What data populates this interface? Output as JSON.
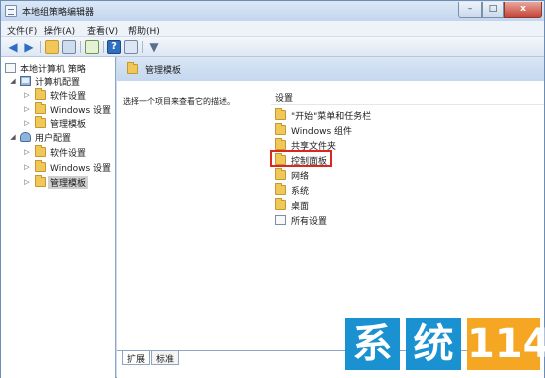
{
  "window": {
    "title": "本地组策略编辑器"
  },
  "titlebar_buttons": {
    "minimize": "–",
    "maximize": "□",
    "close": "x"
  },
  "menu": [
    "文件(F)",
    "操作(A)",
    "查看(V)",
    "帮助(H)"
  ],
  "toolbar_icons": [
    "back-icon",
    "forward-icon",
    "up-folder-icon",
    "show-hide-tree-icon",
    "export-icon",
    "help-icon",
    "properties-icon",
    "filter-icon"
  ],
  "tree": [
    {
      "label": "本地计算机 策略",
      "icon": "doc-icon"
    },
    {
      "label": "计算机配置",
      "icon": "computer-icon",
      "expanded": true
    },
    {
      "label": "软件设置",
      "icon": "folder-icon"
    },
    {
      "label": "Windows 设置",
      "icon": "folder-icon"
    },
    {
      "label": "管理模板",
      "icon": "folder-icon"
    },
    {
      "label": "用户配置",
      "icon": "user-icon",
      "expanded": true
    },
    {
      "label": "软件设置",
      "icon": "folder-icon"
    },
    {
      "label": "Windows 设置",
      "icon": "folder-icon"
    },
    {
      "label": "管理模板",
      "icon": "folder-icon",
      "selected": true
    }
  ],
  "right": {
    "header_title": "管理模板",
    "description": "选择一个项目来查看它的描述。",
    "column_header": "设置",
    "items": [
      {
        "label": "\"开始\"菜单和任务栏",
        "icon": "folder-icon"
      },
      {
        "label": "Windows 组件",
        "icon": "folder-icon"
      },
      {
        "label": "共享文件夹",
        "icon": "folder-icon"
      },
      {
        "label": "控制面板",
        "icon": "folder-icon",
        "highlighted": true
      },
      {
        "label": "网络",
        "icon": "folder-icon"
      },
      {
        "label": "系统",
        "icon": "folder-icon"
      },
      {
        "label": "桌面",
        "icon": "folder-icon"
      },
      {
        "label": "所有设置",
        "icon": "settings-icon"
      }
    ],
    "tabs": [
      "扩展",
      "标准"
    ]
  },
  "watermark": {
    "char1": "系",
    "char2": "统",
    "char3": "114"
  }
}
